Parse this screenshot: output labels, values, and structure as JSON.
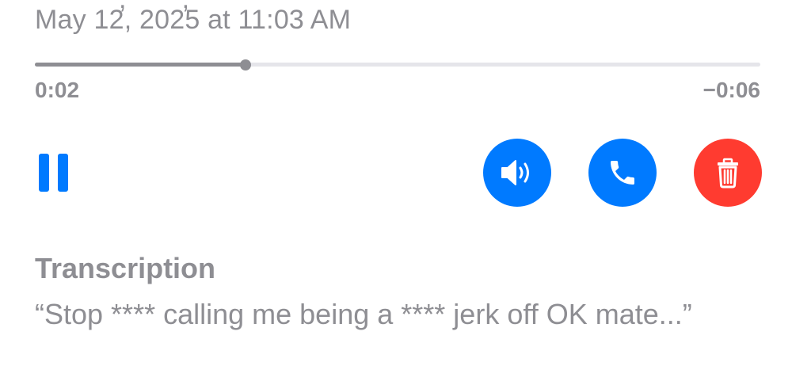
{
  "header": {
    "timestamp": "May 12, 2025 at 11:03 AM"
  },
  "player": {
    "elapsed": "0:02",
    "remaining": "−0:06",
    "progress_fraction": 0.29
  },
  "actions": {
    "pause_icon": "pause-icon",
    "speaker_icon": "speaker-icon",
    "call_icon": "phone-icon",
    "delete_icon": "trash-icon"
  },
  "colors": {
    "accent_blue": "#007aff",
    "destructive_red": "#ff3b30",
    "secondary_gray": "#8e8e93"
  },
  "transcription": {
    "title": "Transcription",
    "text": "“Stop **** calling me being a **** jerk off OK mate...”"
  }
}
